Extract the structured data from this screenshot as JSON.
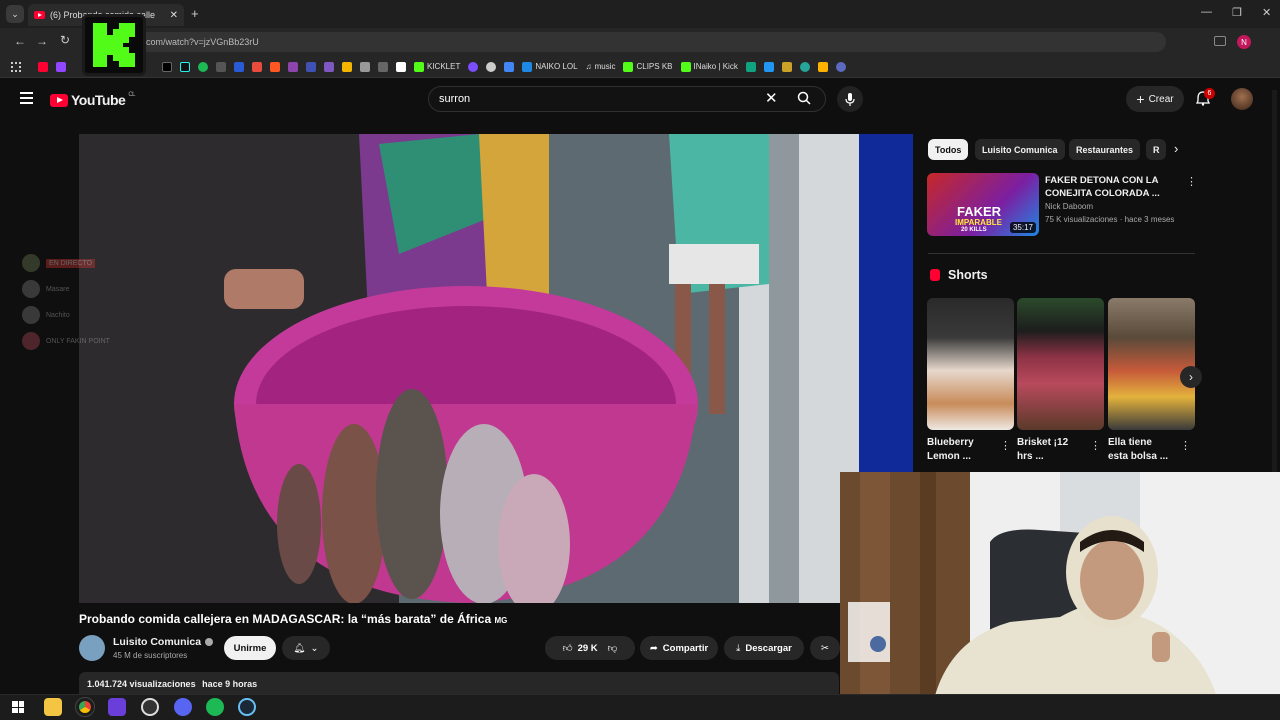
{
  "browser": {
    "tab_title": "(6) Probando comida calle",
    "address": "com/watch?v=jzVGnBb23rU",
    "profile_initial": "N",
    "bookmarks": [
      "KICKLET",
      "NAIKO LOL",
      "music",
      "CLIPS KB",
      "INaiko | Kick"
    ]
  },
  "youtube": {
    "logo": "YouTube",
    "region": "CL",
    "search_value": "surron",
    "create_label": "Crear",
    "notifications_count": "6",
    "video": {
      "title": "Probando comida callejera en MADAGASCAR: la “más barata” de África",
      "flag": "MG",
      "channel": "Luisito Comunica",
      "subscribers": "45 M de suscriptores",
      "join_label": "Unirme",
      "likes": "29 K",
      "share_label": "Compartir",
      "download_label": "Descargar",
      "views": "1.041.724 visualizaciones",
      "age": "hace 9 horas"
    },
    "chips": [
      "Todos",
      "Luisito Comunica",
      "Restaurantes",
      "R"
    ],
    "recommended": {
      "title_line1": "FAKER DETONA CON LA",
      "title_line2": "CONEJITA COLORADA ...",
      "channel": "Nick Daboom",
      "meta": "75 K visualizaciones · hace 3 meses",
      "duration": "35:17",
      "thumb_text1": "FAKER",
      "thumb_text2": "IMPARABLE",
      "thumb_text3": "20 KILLS"
    },
    "shorts_heading": "Shorts",
    "shorts": [
      {
        "line1": "Blueberry",
        "line2": "Lemon ..."
      },
      {
        "line1": "Brisket ¡12",
        "line2": "hrs ..."
      },
      {
        "line1": "Ella tiene",
        "line2": "esta bolsa ..."
      }
    ]
  },
  "stream_overlay": {
    "live_label": "EN DIRECTO",
    "items": [
      "Masare",
      "Nachito",
      "ONLY FAKIN POINT"
    ]
  },
  "icons": [
    "menu-icon",
    "search-icon",
    "close-icon",
    "mic-icon",
    "bell-icon",
    "like-icon",
    "dislike-icon",
    "share-icon",
    "download-icon",
    "chevron-right-icon",
    "windows-icon"
  ]
}
